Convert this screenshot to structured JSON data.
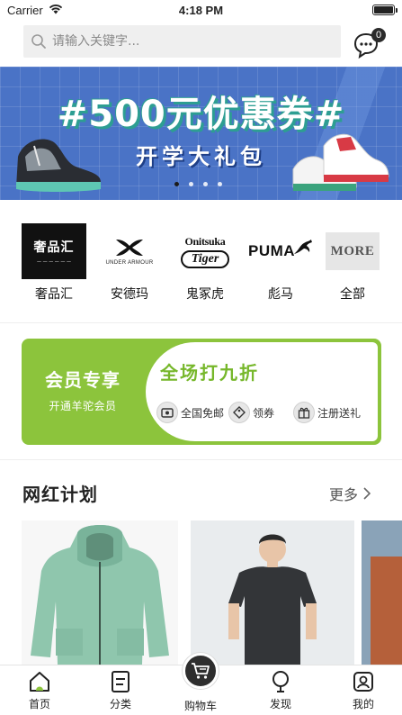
{
  "status_bar": {
    "carrier": "Carrier",
    "time": "4:18 PM"
  },
  "search": {
    "placeholder": "请输入关键字..."
  },
  "messages": {
    "badge_count": "0"
  },
  "banner": {
    "title": "#500元优惠券#",
    "subtitle": "开学大礼包",
    "dots": 4,
    "active_dot": 0,
    "colors": {
      "background": "#4a73c6",
      "title_shadow": "#2d9e92"
    }
  },
  "brands": [
    {
      "logo_text": "奢品汇",
      "name": "奢品汇"
    },
    {
      "logo_text": "UNDER ARMOUR",
      "name": "安德玛"
    },
    {
      "logo_text_top": "Onitsuka",
      "logo_text_bottom": "Tiger",
      "name": "鬼冢虎"
    },
    {
      "logo_text": "PUMA",
      "name": "彪马"
    },
    {
      "logo_text": "MORE",
      "name": "全部"
    }
  ],
  "member_card": {
    "title": "会员专享",
    "subtitle": "开通羊驼会员",
    "headline": "全场打九折",
    "perks": [
      "全国免邮",
      "领券",
      "注册送礼"
    ],
    "colors": {
      "accent": "#8cc43c",
      "headline": "#76b72a"
    }
  },
  "section": {
    "title": "网红计划",
    "more_label": "更多"
  },
  "tabs": [
    {
      "label": "首页",
      "icon": "home-icon"
    },
    {
      "label": "分类",
      "icon": "category-icon"
    },
    {
      "label": "购物车",
      "icon": "cart-icon"
    },
    {
      "label": "发现",
      "icon": "discover-icon"
    },
    {
      "label": "我的",
      "icon": "profile-icon"
    }
  ]
}
